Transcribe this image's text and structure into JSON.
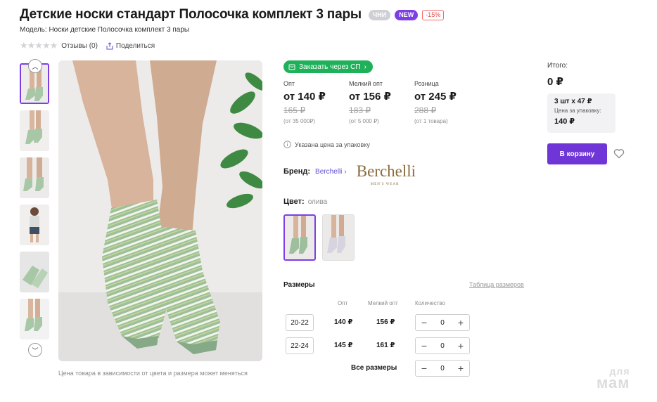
{
  "header": {
    "title": "Детские носки стандарт Полосочка комплект 3 пары",
    "badges": [
      "ЧНИ",
      "NEW",
      "-15%"
    ],
    "model": "Модель: Носки детские Полосочка комплект 3 пары",
    "reviews": "Отзывы (0)",
    "share": "Поделиться",
    "rating_stars": 0
  },
  "gallery": {
    "caption": "Цена товара в зависимости от цвета и размера может меняться",
    "thumb_count": 6,
    "active_thumb": 0
  },
  "order": {
    "sp_button": "Заказать через СП",
    "prices": [
      {
        "label": "Опт",
        "main": "от 140 ₽",
        "old": "165 ₽",
        "note": "(от 35 000₽)"
      },
      {
        "label": "Мелкий опт",
        "main": "от 156 ₽",
        "old": "183 ₽",
        "note": "(от 5 000 ₽)"
      },
      {
        "label": "Розница",
        "main": "от 245 ₽",
        "old": "288 ₽",
        "note": "(от 1 товара)"
      }
    ],
    "pack_note": "Указана цена за упаковку"
  },
  "brand": {
    "label": "Бренд:",
    "name": "Berchelli",
    "link_arrow": "›",
    "logo_text": "Berchelli",
    "logo_sub": "MEN'S WEAR"
  },
  "color": {
    "label": "Цвет:",
    "value": "олива"
  },
  "sizes": {
    "title": "Размеры",
    "table_link": "Таблица размеров",
    "headers": {
      "opt": "Опт",
      "small": "Мелкий опт",
      "qty": "Количество"
    },
    "rows": [
      {
        "size": "20-22",
        "opt": "140 ₽",
        "small": "156 ₽",
        "qty": "0"
      },
      {
        "size": "22-24",
        "opt": "145 ₽",
        "small": "161 ₽",
        "qty": "0"
      }
    ],
    "all_label": "Все размеры",
    "all_qty": "0"
  },
  "summary": {
    "total_label": "Итого:",
    "total_value": "0 ₽",
    "pack_line1": "3 шт х 47 ₽",
    "pack_line2": "Цена за упаковку:",
    "pack_line3": "140 ₽",
    "cart_button": "В корзину"
  },
  "watermark": {
    "line1": "для",
    "line2": "мам"
  },
  "colors": {
    "accent": "#7b3fe4",
    "green": "#1fb15a",
    "sock": "#9dbf9e"
  }
}
